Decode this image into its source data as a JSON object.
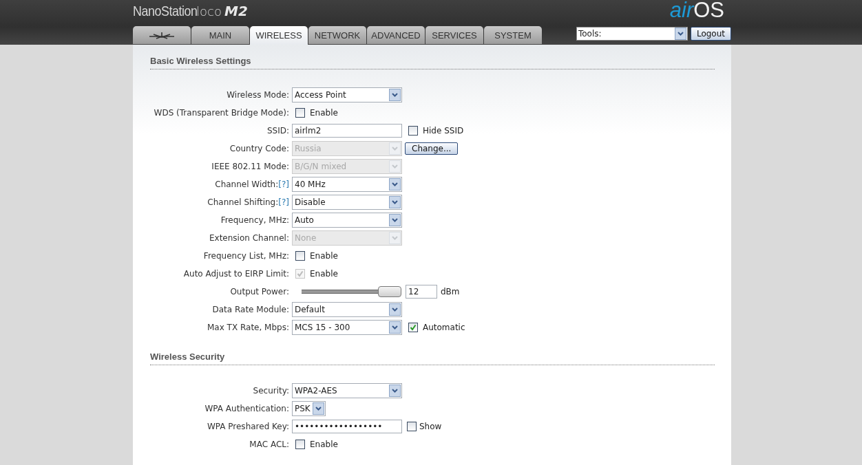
{
  "header": {
    "product": "NanoStation",
    "model": "loco",
    "version": "M2",
    "logo_a": "air",
    "logo_b": "OS"
  },
  "tabs": [
    {
      "kind": "icon",
      "selected": false
    },
    {
      "kind": "text",
      "label": "MAIN",
      "selected": false
    },
    {
      "kind": "text",
      "label": "WIRELESS",
      "selected": true
    },
    {
      "kind": "text",
      "label": "NETWORK",
      "selected": false
    },
    {
      "kind": "text",
      "label": "ADVANCED",
      "selected": false
    },
    {
      "kind": "text",
      "label": "SERVICES",
      "selected": false
    },
    {
      "kind": "text",
      "label": "SYSTEM",
      "selected": false
    }
  ],
  "tools": {
    "value": "Tools:",
    "button": "Logout"
  },
  "sections": [
    {
      "title": "Basic Wireless Settings",
      "rows": [
        {
          "label": "Wireless Mode:",
          "kind": "select",
          "value": "Access Point",
          "disabled": false
        },
        {
          "label": "WDS (Transparent Bridge Mode):",
          "kind": "checkbox",
          "checked": false,
          "disabled": false,
          "text": "Enable"
        },
        {
          "label": "SSID:",
          "kind": "input",
          "value": "airlm2",
          "extra": {
            "kind": "checkbox",
            "checked": false,
            "text": "Hide SSID"
          }
        },
        {
          "label": "Country Code:",
          "kind": "select",
          "value": "Russia",
          "disabled": true,
          "extra": {
            "kind": "button",
            "text": "Change..."
          }
        },
        {
          "label": "IEEE 802.11 Mode:",
          "kind": "select",
          "value": "B/G/N mixed",
          "disabled": true
        },
        {
          "label": "Channel Width:",
          "help": "[?]",
          "kind": "select",
          "value": "40 MHz",
          "disabled": false
        },
        {
          "label": "Channel Shifting:",
          "help": "[?]",
          "kind": "select",
          "value": "Disable",
          "disabled": false
        },
        {
          "label": "Frequency, MHz:",
          "kind": "select",
          "value": "Auto",
          "disabled": false
        },
        {
          "label": "Extension Channel:",
          "kind": "select",
          "value": "None",
          "disabled": true
        },
        {
          "label": "Frequency List, MHz:",
          "kind": "checkbox",
          "checked": false,
          "disabled": false,
          "text": "Enable"
        },
        {
          "label": "Auto Adjust to EIRP Limit:",
          "kind": "checkbox",
          "checked": true,
          "disabled": true,
          "text": "Enable"
        },
        {
          "label": "Output Power:",
          "kind": "slider",
          "level": 1,
          "value": "12",
          "unit": "dBm"
        },
        {
          "label": "Data Rate Module:",
          "kind": "select",
          "value": "Default",
          "disabled": false
        },
        {
          "label": "Max TX Rate, Mbps:",
          "kind": "select",
          "value": "MCS 15 - 300",
          "disabled": false,
          "extra": {
            "kind": "checkbox",
            "checked": true,
            "text": "Automatic"
          }
        }
      ]
    },
    {
      "title": "Wireless Security",
      "rows": [
        {
          "label": "Security:",
          "kind": "select",
          "value": "WPA2-AES",
          "disabled": false
        },
        {
          "label": "WPA Authentication:",
          "kind": "small-select",
          "value": "PSK",
          "disabled": false
        },
        {
          "label": "WPA Preshared Key:",
          "kind": "input",
          "value": "••••••••••••••••••",
          "extra": {
            "kind": "small-checkbox",
            "checked": false,
            "text": "Show"
          }
        },
        {
          "label": "MAC ACL:",
          "kind": "checkbox",
          "checked": false,
          "disabled": false,
          "text": "Enable"
        }
      ]
    }
  ]
}
